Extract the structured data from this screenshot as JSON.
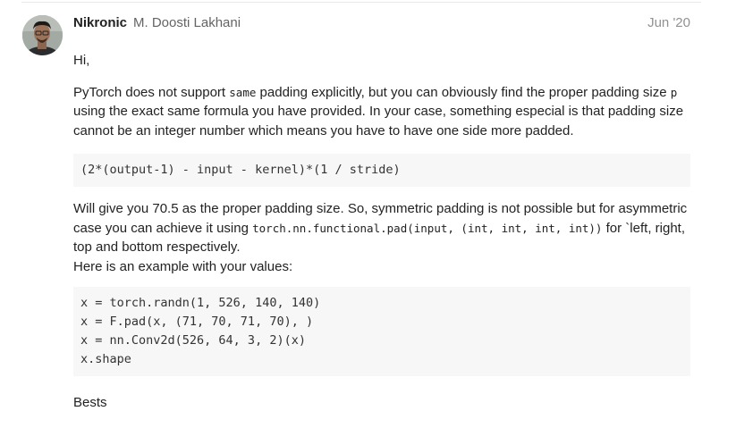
{
  "post": {
    "username": "Nikronic",
    "full_name": "M. Doosti Lakhani",
    "date": "Jun '20",
    "greeting": "Hi,",
    "intro": {
      "part1": "PyTorch does not support ",
      "code1": "same",
      "part2": " padding explicitly, but you can obviously find the proper padding size ",
      "code2": "p",
      "part3": " using the exact same formula you have provided. In your case, something especial is that padding size cannot be an integer number which means you have to have one side more padded."
    },
    "formula_code": "(2*(output-1) - input - kernel)*(1 / stride)",
    "explanation": {
      "part1": "Will give you 70.5 as the proper padding size. So, symmetric padding is not possible but for asymmetric case you can achieve it using ",
      "code1": "torch.nn.functional.pad(input, (int, int, int, int))",
      "part2": " for `left, right, top and bottom respectively.",
      "line2": "Here is an example with your values:"
    },
    "example_code": [
      "x = torch.randn(1, 526, 140, 140)",
      "x = F.pad(x, (71, 70, 71, 70), )",
      "x = nn.Conv2d(526, 64, 3, 2)(x)",
      "x.shape"
    ],
    "closing": "Bests"
  }
}
